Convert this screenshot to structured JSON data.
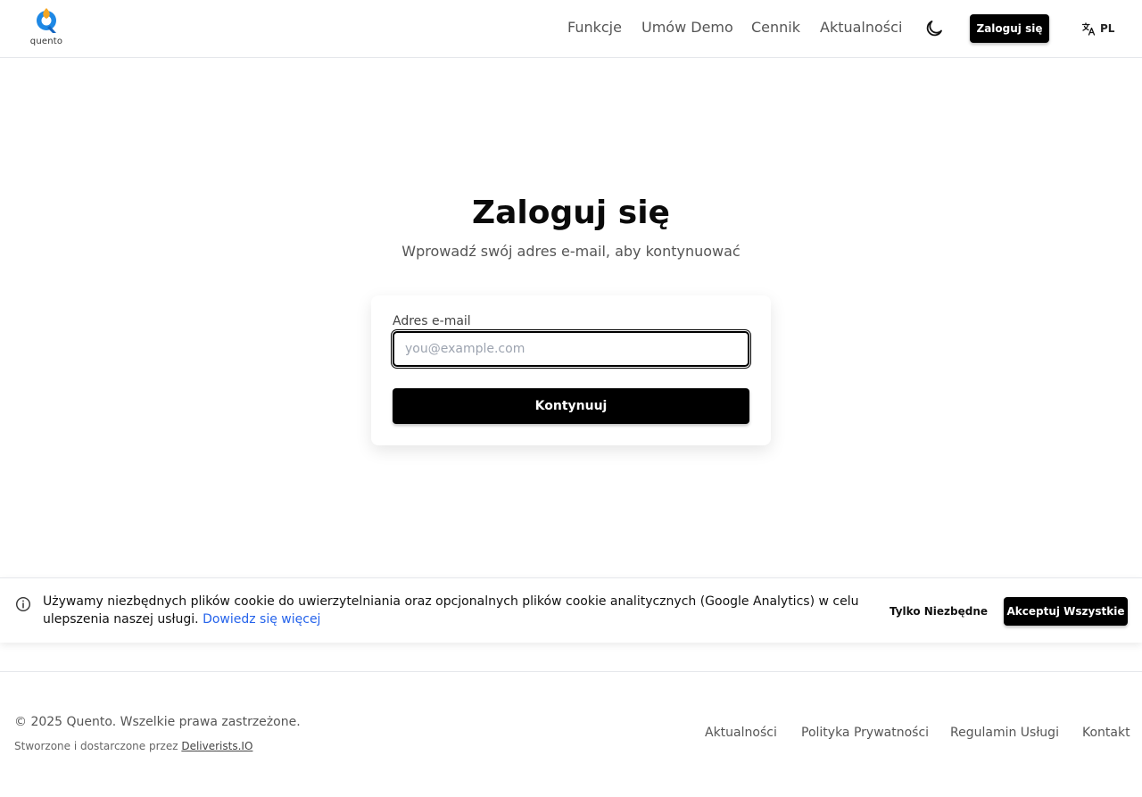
{
  "header": {
    "logo_text": "quento",
    "nav": [
      "Funkcje",
      "Umów Demo",
      "Cennik",
      "Aktualności"
    ],
    "theme_icon": "moon-icon",
    "login_label": "Zaloguj się",
    "lang_icon": "translate-icon",
    "lang_code": "PL"
  },
  "main": {
    "title": "Zaloguj się",
    "subtitle": "Wprowadź swój adres e-mail, aby kontynuować",
    "email_label": "Adres e-mail",
    "email_placeholder": "you@example.com",
    "email_value": "",
    "continue_label": "Kontynuuj"
  },
  "cookie": {
    "icon": "info-icon",
    "text": "Używamy niezbędnych plików cookie do uwierzytelniania oraz opcjonalnych plików cookie analitycznych (Google Analytics) w celu ulepszenia naszej usługi.",
    "link": "Dowiedz się więcej",
    "necessary_label": "Tylko Niezbędne",
    "accept_label": "Akceptuj Wszystkie"
  },
  "footer": {
    "copyright": "© 2025 Quento. Wszelkie prawa zastrzeżone.",
    "credits_prefix": "Stworzone i dostarczone przez",
    "credits_link": "Deliverists.IO",
    "links": [
      "Aktualności",
      "Polityka Prywatności",
      "Regulamin Usługi",
      "Kontakt"
    ]
  },
  "colors": {
    "primary": "#000000",
    "link": "#2563eb",
    "logo_blue": "#1e88e5",
    "logo_orange": "#f5a623"
  }
}
